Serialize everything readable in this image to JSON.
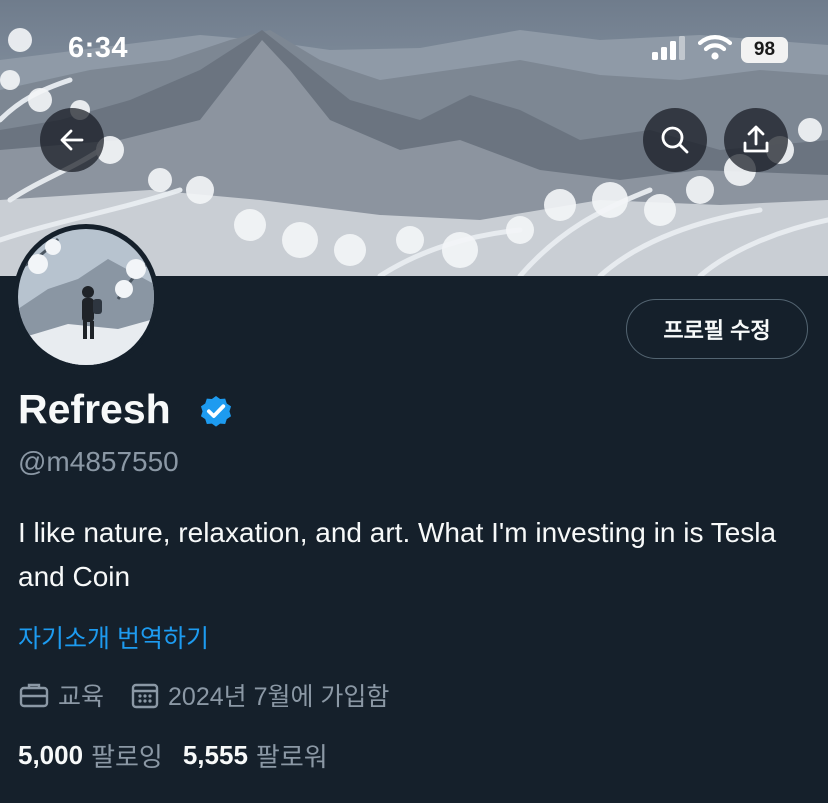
{
  "status_bar": {
    "time": "6:34",
    "battery": "98",
    "icons": [
      "cellular-signal-icon",
      "wifi-icon",
      "battery-icon"
    ]
  },
  "header": {
    "back_icon": "back-arrow-icon",
    "search_icon": "search-icon",
    "share_icon": "share-icon",
    "banner": "snowy mountain landscape photo"
  },
  "profile": {
    "edit_button": "프로필 수정",
    "display_name": "Refresh",
    "verified_icon": "verified-badge-icon",
    "handle": "@m4857550",
    "bio": "I like nature, relaxation, and art. What I'm investing in is Tesla and Coin",
    "translate_link": "자기소개 번역하기",
    "category": "교육",
    "joined": "2024년 7월에 가입함",
    "following_count": "5,000",
    "following_label": "팔로잉",
    "followers_count": "5,555",
    "followers_label": "팔로워"
  },
  "colors": {
    "background": "#15202b",
    "accent_blue": "#1d9bf0",
    "secondary_text": "#8b98a5",
    "border": "#536471"
  }
}
